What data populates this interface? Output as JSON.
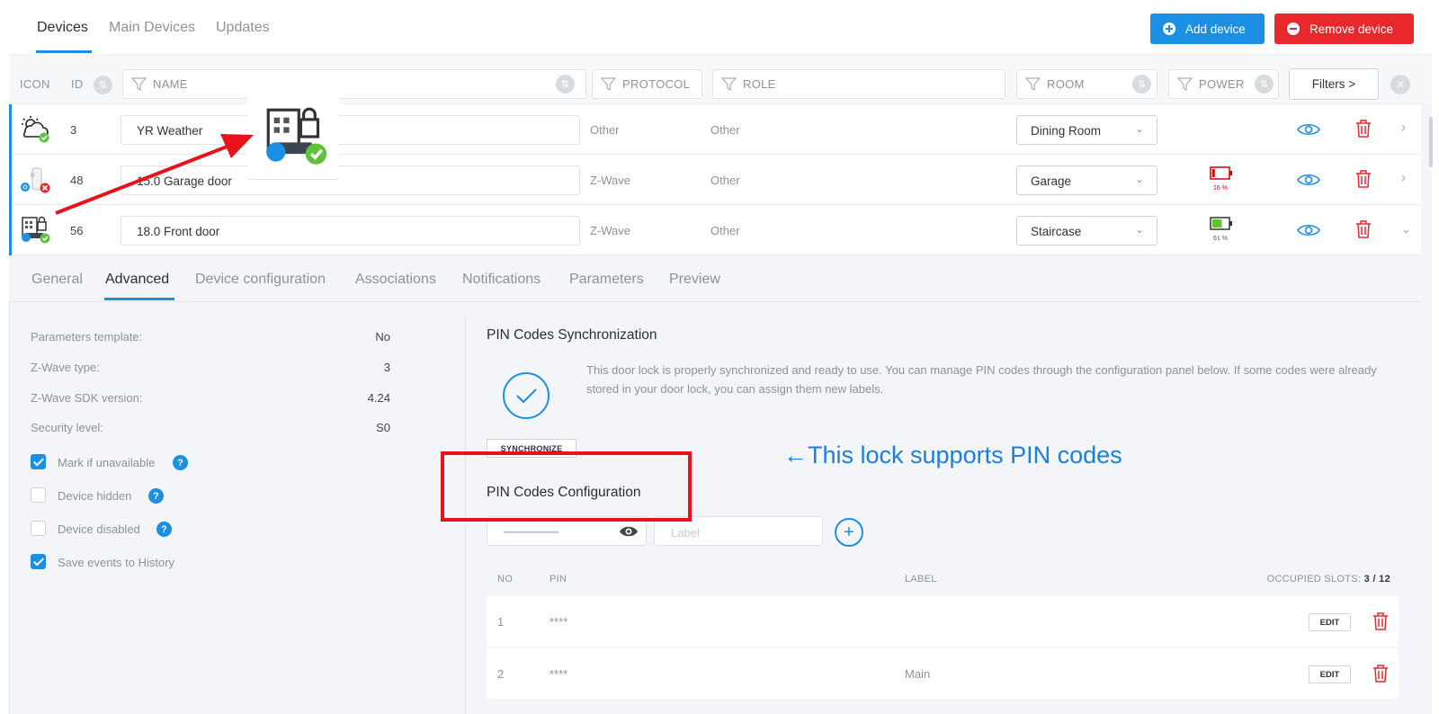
{
  "top_tabs": [
    {
      "label": "Devices",
      "active": true
    },
    {
      "label": "Main Devices",
      "active": false
    },
    {
      "label": "Updates",
      "active": false
    }
  ],
  "actions": {
    "add_device": "Add device",
    "remove_device": "Remove device"
  },
  "colors": {
    "accent": "#1a8fe3",
    "danger": "#e8282d",
    "annotation_red": "#e8131a",
    "annotation_text": "#1a7fe0"
  },
  "table_header": {
    "icon": "ICON",
    "id": "ID",
    "name": "NAME",
    "protocol": "PROTOCOL",
    "role": "ROLE",
    "room": "ROOM",
    "power": "POWER",
    "filters": "Filters >"
  },
  "devices": [
    {
      "icon": "weather-icon",
      "id": "3",
      "name": "YR Weather",
      "protocol": "Other",
      "role": "Other",
      "room": "Dining Room",
      "battery": null,
      "expanded": false
    },
    {
      "icon": "door-sensor-icon",
      "id": "48",
      "name": "15.0 Garage door",
      "protocol": "Z-Wave",
      "role": "Other",
      "room": "Garage",
      "battery": {
        "percent": 16,
        "label": "16 %",
        "level": "low"
      },
      "expanded": false
    },
    {
      "icon": "door-lock-icon",
      "id": "56",
      "name": "18.0 Front door",
      "protocol": "Z-Wave",
      "role": "Other",
      "room": "Staircase",
      "battery": {
        "percent": 61,
        "label": "61 %",
        "level": "ok"
      },
      "expanded": true
    }
  ],
  "detail_tabs": [
    {
      "label": "General",
      "active": false
    },
    {
      "label": "Advanced",
      "active": true
    },
    {
      "label": "Device configuration",
      "active": false
    },
    {
      "label": "Associations",
      "active": false
    },
    {
      "label": "Notifications",
      "active": false
    },
    {
      "label": "Parameters",
      "active": false
    },
    {
      "label": "Preview",
      "active": false
    }
  ],
  "properties": [
    {
      "label": "Parameters template:",
      "value": "No"
    },
    {
      "label": "Z-Wave type:",
      "value": "3"
    },
    {
      "label": "Z-Wave SDK version:",
      "value": "4.24"
    },
    {
      "label": "Security level:",
      "value": "S0"
    }
  ],
  "checkboxes": [
    {
      "label": "Mark if unavailable",
      "checked": true,
      "help": true
    },
    {
      "label": "Device hidden",
      "checked": false,
      "help": true
    },
    {
      "label": "Device disabled",
      "checked": false,
      "help": true
    },
    {
      "label": "Save events to History",
      "checked": true,
      "help": false
    }
  ],
  "pin_sync": {
    "title": "PIN Codes Synchronization",
    "text": "This door lock is properly synchronized and ready to use. You can manage PIN codes through the configuration panel below. If some codes were already stored in your door lock, you can assign them new labels.",
    "button": "SYNCHRONIZE"
  },
  "annotation": {
    "text": "←This lock supports PIN codes"
  },
  "pin_config": {
    "title": "PIN Codes Configuration",
    "pin_mask": "•••••••••••••••••••••••",
    "label_placeholder": "Label",
    "columns": {
      "no": "NO",
      "pin": "PIN",
      "label": "LABEL"
    },
    "occupied_label": "OCCUPIED SLOTS:",
    "occupied_value": "3 / 12",
    "rows": [
      {
        "no": "1",
        "pin": "****",
        "label": "",
        "edit": "EDIT"
      },
      {
        "no": "2",
        "pin": "****",
        "label": "Main",
        "edit": "EDIT"
      }
    ]
  }
}
